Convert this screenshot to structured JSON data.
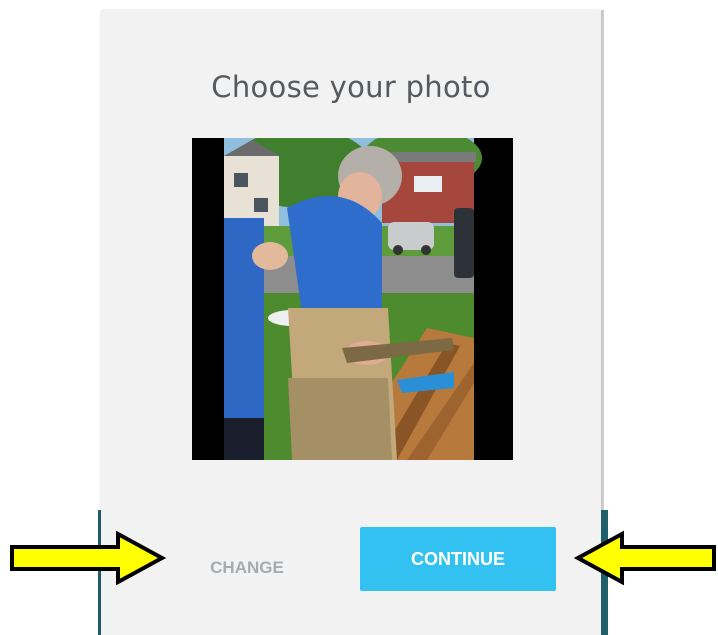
{
  "dialog": {
    "title": "Choose your photo",
    "change_label": "CHANGE",
    "continue_label": "CONTINUE"
  },
  "colors": {
    "continue_button": "#33c1f1",
    "change_text": "#a7abae",
    "annotation_arrow": "#ffff00",
    "backdrop": "#1f5f6a"
  },
  "annotations": {
    "left_arrow_icon": "arrow-right-icon",
    "right_arrow_icon": "arrow-left-icon"
  }
}
